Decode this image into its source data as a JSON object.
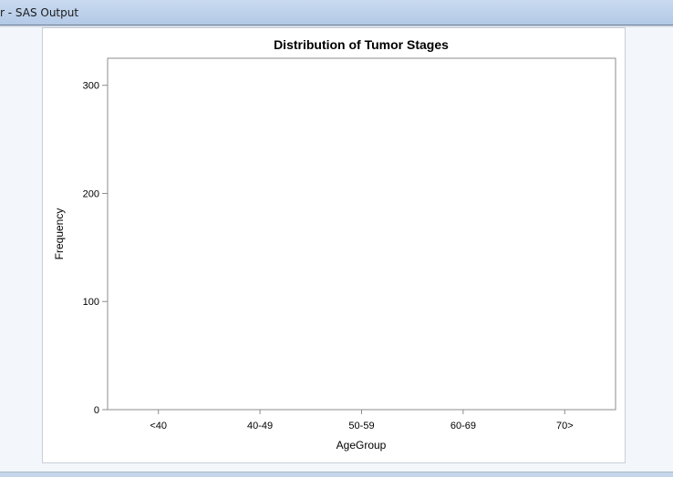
{
  "window": {
    "title": "r - SAS Output"
  },
  "chart_data": {
    "type": "bar",
    "title": "Distribution of Tumor Stages",
    "xlabel": "AgeGroup",
    "ylabel": "Frequency",
    "categories": [
      "<40",
      "40-49",
      "50-59",
      "60-69",
      "70>"
    ],
    "y_ticks": [
      0,
      100,
      200,
      300
    ],
    "ylim": [
      0,
      325
    ],
    "series": [],
    "grid": false,
    "legend": "none"
  }
}
